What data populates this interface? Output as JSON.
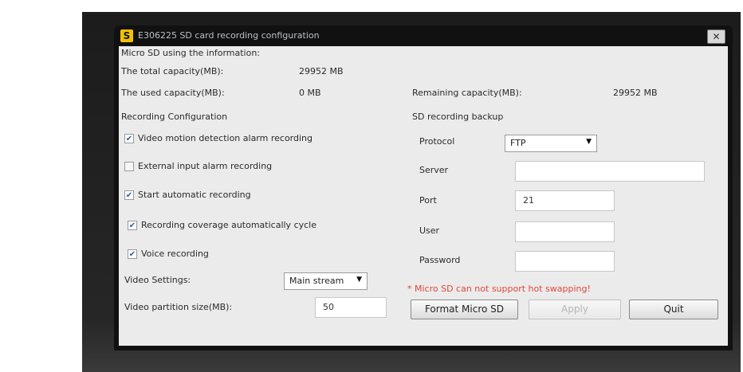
{
  "window": {
    "title": "E306225 SD card recording configuration",
    "icon": "app-icon",
    "close_label": "✕"
  },
  "sd_info": {
    "heading": "Micro SD using the information:",
    "total_label": "The total capacity(MB):",
    "total_value": "29952 MB",
    "used_label": "The used capacity(MB):",
    "used_value": "0 MB",
    "remaining_label": "Remaining capacity(MB):",
    "remaining_value": "29952 MB"
  },
  "recording": {
    "heading": "Recording Configuration",
    "options": [
      {
        "label": "Video motion detection alarm recording",
        "checked": true
      },
      {
        "label": "External input alarm recording",
        "checked": false
      },
      {
        "label": "Start automatic recording",
        "checked": true
      },
      {
        "label": "Recording coverage automatically cycle",
        "checked": true
      },
      {
        "label": "Voice recording",
        "checked": true
      }
    ],
    "video_settings_label": "Video Settings:",
    "video_settings_value": "Main stream",
    "partition_label": "Video partition size(MB):",
    "partition_value": "50"
  },
  "backup": {
    "heading": "SD recording backup",
    "protocol_label": "Protocol",
    "protocol_value": "FTP",
    "server_label": "Server",
    "server_value": "",
    "port_label": "Port",
    "port_value": "21",
    "user_label": "User",
    "user_value": "",
    "password_label": "Password",
    "password_value": ""
  },
  "warning": "* Micro SD can not support hot swapping!",
  "buttons": {
    "format": "Format Micro SD",
    "apply": "Apply",
    "quit": "Quit"
  },
  "colors": {
    "warning": "#e0473a",
    "dialog_bg": "#ebebeb",
    "title_bar": "#111111",
    "checkmark": "#2f5fa0"
  }
}
